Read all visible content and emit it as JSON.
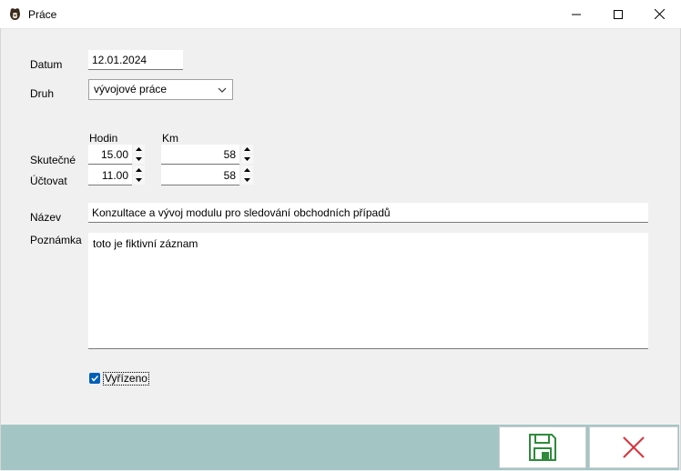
{
  "window": {
    "title": "Práce"
  },
  "form": {
    "datum_label": "Datum",
    "datum_value": "12.01.2024",
    "druh_label": "Druh",
    "druh_value": "vývojové práce",
    "hodin_header": "Hodin",
    "km_header": "Km",
    "skutecne_label": "Skutečné",
    "uctovat_label": "Účtovat",
    "skutecne_hodin": "15.00",
    "skutecne_km": "58",
    "uctovat_hodin": "11.00",
    "uctovat_km": "58",
    "nazev_label": "Název",
    "nazev_value": "Konzultace a vývoj modulu pro sledování obchodních případů",
    "poznamka_label": "Poznámka",
    "poznamka_value": "toto je fiktivní záznam",
    "vyrizeno_label": "Vyřízeno",
    "vyrizeno_checked": true
  },
  "colors": {
    "footer": "#a3c6c5",
    "save_icon": "#2e8b3a",
    "cancel_icon": "#d9333b",
    "checkbox": "#005fb8"
  },
  "icons": {
    "app": "dog-icon",
    "save": "floppy-disk-icon",
    "cancel": "close-x-icon"
  }
}
